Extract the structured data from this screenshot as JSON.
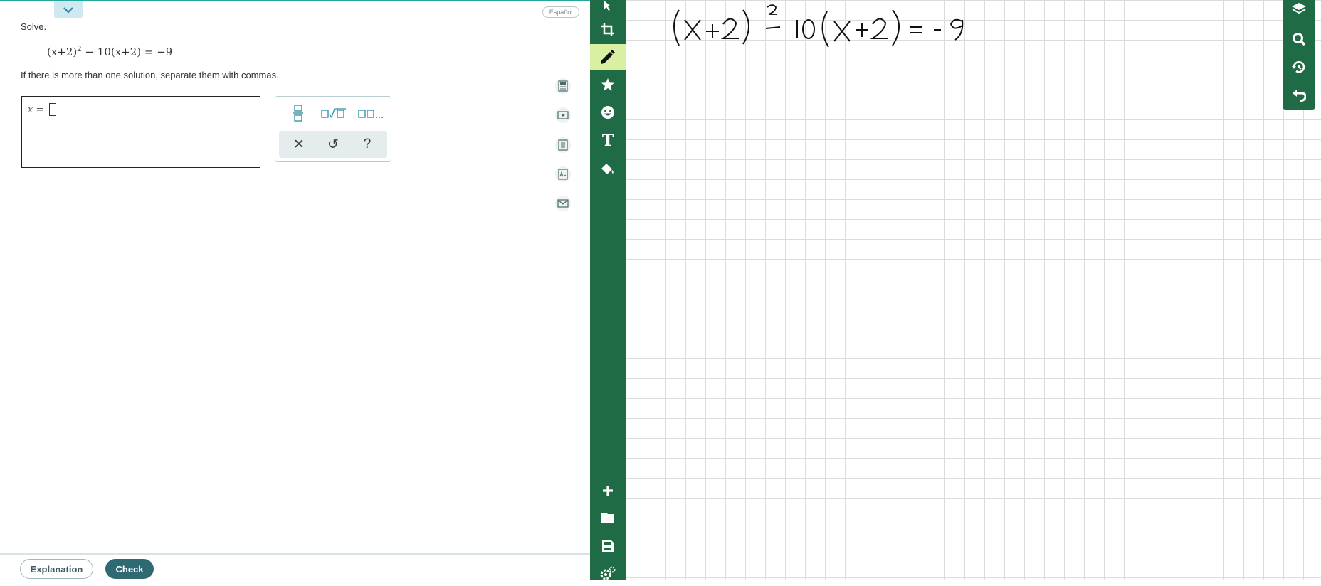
{
  "problem": {
    "prompt": "Solve.",
    "equation": {
      "part1": "(x+2)",
      "exponent": "2",
      "part2": "− 10(x+2) = −9"
    },
    "instruction": "If there is more than one solution, separate them with commas.",
    "answer_label": "x ="
  },
  "language_button": "Español",
  "palette": {
    "keys": [
      "fraction",
      "square-root",
      "list"
    ],
    "actions": {
      "clear": "✕",
      "undo": "↺",
      "help": "?"
    }
  },
  "footer": {
    "explanation": "Explanation",
    "check": "Check"
  },
  "toolbar_tools": [
    "pointer",
    "crop",
    "pen",
    "star",
    "emoji",
    "text",
    "fill",
    "add",
    "folder",
    "save",
    "settings"
  ],
  "right_panel_tools": [
    "layers",
    "search",
    "history",
    "undo"
  ],
  "handwriting": {
    "part1": "(X+2)",
    "exponent": "2",
    "part2": "− 10(X+2) = -9"
  },
  "colors": {
    "toolbar": "#1f6b45",
    "active_tool": "#d9f0a3",
    "accent": "#2a8aa3",
    "check_button": "#2f6a72"
  }
}
